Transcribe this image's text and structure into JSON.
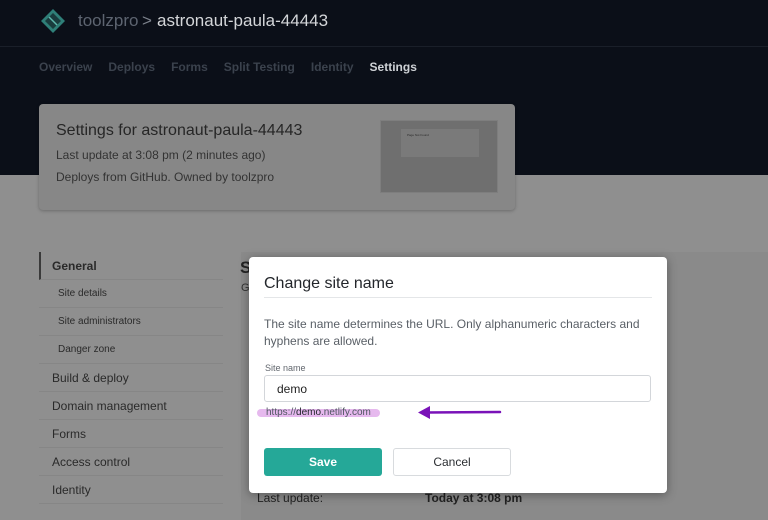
{
  "header": {
    "logo_icon": "netlify-logo-icon",
    "team": "toolzpro",
    "separator": ">",
    "site": "astronaut-paula-44443"
  },
  "nav": {
    "items": [
      "Overview",
      "Deploys",
      "Forms",
      "Split Testing",
      "Identity",
      "Settings"
    ],
    "active": "Settings"
  },
  "card": {
    "title": "Settings for astronaut-paula-44443",
    "last_update": "Last update at 3:08 pm (2 minutes ago)",
    "deploys_from": "Deploys from GitHub. Owned by toolzpro",
    "thumbnail_text": "Page Not Found"
  },
  "sidebar": {
    "items": [
      "General",
      "Site details",
      "Site administrators",
      "Danger zone",
      "Build & deploy",
      "Domain management",
      "Forms",
      "Access control",
      "Identity"
    ],
    "active": "General"
  },
  "background": {
    "section_heading": "S",
    "section_sub": "G",
    "last_update_label": "Last update:",
    "last_update_value": "Today at 3:08 pm"
  },
  "modal": {
    "title": "Change site name",
    "description": "The site name determines the URL. Only alphanumeric characters and hyphens are allowed.",
    "field_label": "Site name",
    "field_value": "demo",
    "url_prefix": "https://",
    "url_domain": "demo",
    "url_suffix": ".netlify.com",
    "save_label": "Save",
    "cancel_label": "Cancel"
  },
  "colors": {
    "accent": "#25a898",
    "annotation": "#7a13b8",
    "highlight": "#e6b9ee"
  }
}
